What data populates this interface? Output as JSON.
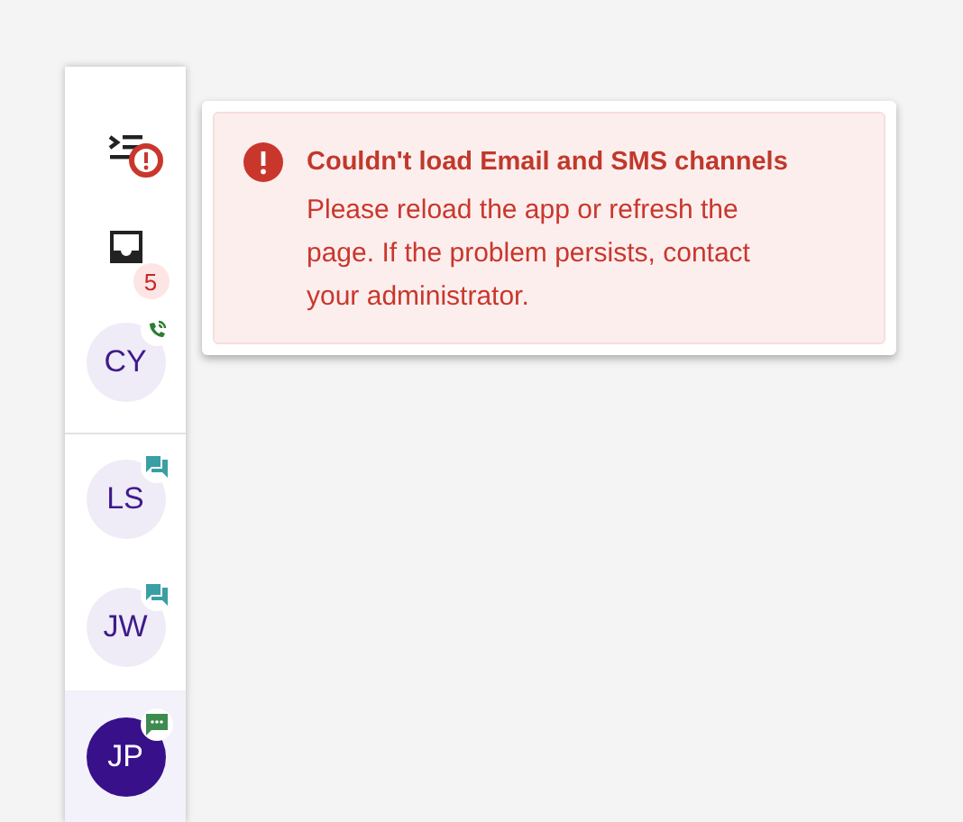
{
  "sidebar": {
    "menu": {
      "alert": true
    },
    "inbox": {
      "badge": "5"
    },
    "active_call": [
      {
        "initials": "CY",
        "kind": "phone",
        "selected": false
      }
    ],
    "conversations": [
      {
        "initials": "LS",
        "kind": "chat",
        "selected": false
      },
      {
        "initials": "JW",
        "kind": "chat",
        "selected": false
      },
      {
        "initials": "JP",
        "kind": "sms",
        "selected": true
      }
    ]
  },
  "alert": {
    "title": "Couldn't load Email and SMS channels",
    "message": "Please reload the app or refresh the page. If the problem persists, contact your administrator."
  }
}
